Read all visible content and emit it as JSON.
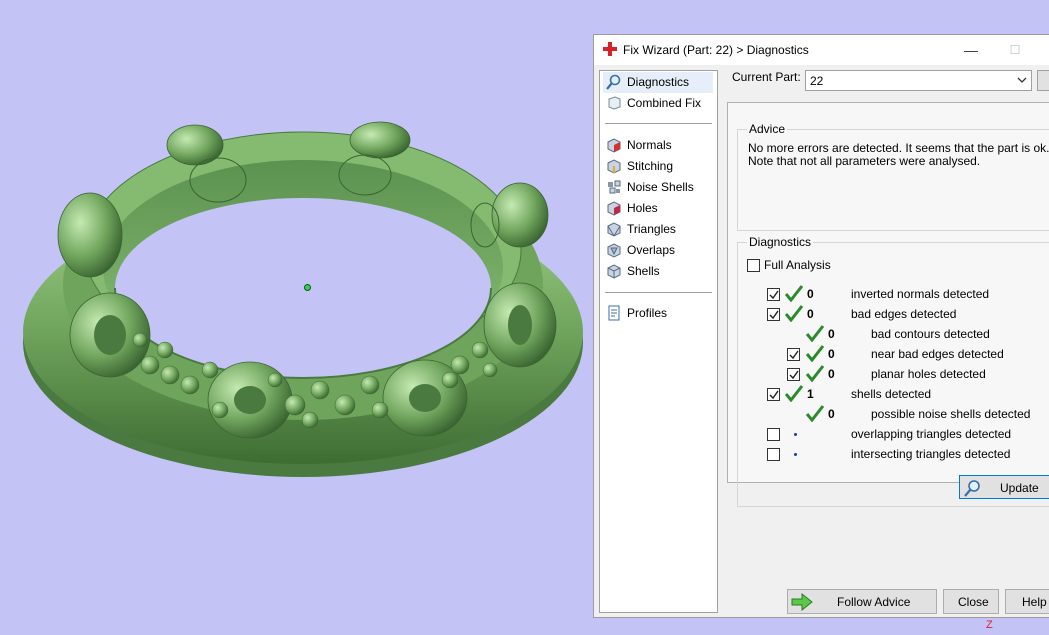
{
  "window": {
    "title": "Fix Wizard (Part: 22) > Diagnostics",
    "minimize_glyph": "—",
    "maximize_glyph": "☐"
  },
  "nav": {
    "items": [
      {
        "label": "Diagnostics",
        "icon": "magnifier-icon",
        "selected": true
      },
      {
        "label": "Combined Fix",
        "icon": "combined-fix-icon"
      },
      {
        "label": "Normals",
        "icon": "normals-icon"
      },
      {
        "label": "Stitching",
        "icon": "stitching-icon"
      },
      {
        "label": "Noise Shells",
        "icon": "noise-shells-icon"
      },
      {
        "label": "Holes",
        "icon": "holes-icon"
      },
      {
        "label": "Triangles",
        "icon": "triangles-icon"
      },
      {
        "label": "Overlaps",
        "icon": "overlaps-icon"
      },
      {
        "label": "Shells",
        "icon": "shells-icon"
      },
      {
        "label": "Profiles",
        "icon": "profiles-icon"
      }
    ]
  },
  "current_part": {
    "label": "Current Part:",
    "value": "22"
  },
  "advice": {
    "title": "Advice",
    "line1": "No more errors are detected. It seems that the part is ok.",
    "line2": "Note that not all parameters were analysed."
  },
  "diagnostics": {
    "title": "Diagnostics",
    "full_analysis_label": "Full Analysis",
    "full_analysis_checked": false,
    "rows": [
      {
        "checkbox": true,
        "checked": true,
        "status": "ok",
        "count": "0",
        "label": "inverted normals detected"
      },
      {
        "checkbox": true,
        "checked": true,
        "status": "ok",
        "count": "0",
        "label": "bad edges detected"
      },
      {
        "checkbox": false,
        "status": "ok",
        "count": "0",
        "label": "bad contours detected"
      },
      {
        "checkbox": true,
        "checked": true,
        "status": "ok",
        "count": "0",
        "label": "near bad edges detected"
      },
      {
        "checkbox": true,
        "checked": true,
        "status": "ok",
        "count": "0",
        "label": "planar holes detected"
      },
      {
        "checkbox": true,
        "checked": true,
        "status": "ok",
        "count": "1",
        "label": "shells detected"
      },
      {
        "checkbox": false,
        "status": "ok",
        "count": "0",
        "label": "possible noise shells detected"
      },
      {
        "checkbox": true,
        "checked": false,
        "status": "pending",
        "count": "",
        "label": "overlapping triangles detected"
      },
      {
        "checkbox": true,
        "checked": false,
        "status": "pending",
        "count": "",
        "label": "intersecting triangles detected"
      }
    ]
  },
  "buttons": {
    "update": "Update",
    "follow_advice": "Follow Advice",
    "close": "Close",
    "help": "Help"
  },
  "viewport": {
    "axis_label": "Z"
  },
  "colors": {
    "viewport_bg": "#c4c3f5",
    "model_green": "#6fa45c",
    "check_green": "#2c8a2c",
    "title_icon_red": "#d8222a"
  }
}
